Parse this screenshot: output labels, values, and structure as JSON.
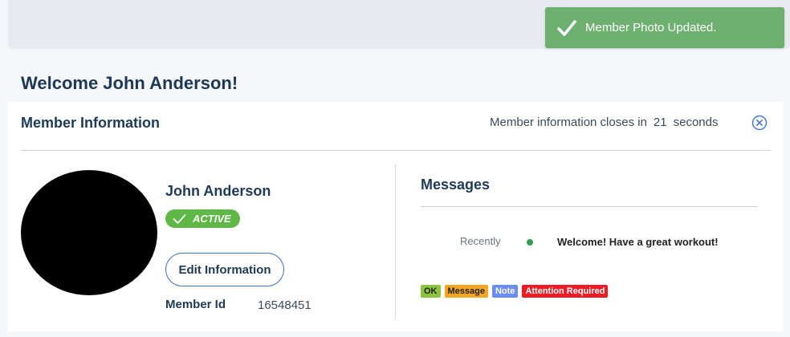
{
  "toast": {
    "message": "Member Photo Updated.",
    "icon": "checkmark-icon",
    "color": "#6db06f"
  },
  "page": {
    "welcome": "Welcome John Anderson!"
  },
  "member_panel": {
    "title": "Member Information",
    "countdown_prefix": "Member information closes in",
    "countdown_value": "21",
    "countdown_suffix": "seconds",
    "close_icon": "close-circle-icon"
  },
  "member": {
    "name": "John Anderson",
    "status": "ACTIVE",
    "status_color": "#5fb846",
    "edit_button": "Edit Information",
    "member_id_label": "Member Id",
    "member_id": "16548451"
  },
  "messages": {
    "title": "Messages",
    "items": [
      {
        "time": "Recently",
        "dot_color": "#2ea04f",
        "text": "Welcome! Have a great workout!"
      }
    ],
    "legend": [
      {
        "label": "OK",
        "color": "#8dc43f"
      },
      {
        "label": "Message",
        "color": "#f5a623"
      },
      {
        "label": "Note",
        "color": "#6b8cf5"
      },
      {
        "label": "Attention Required",
        "color": "#ec1b24"
      }
    ]
  }
}
